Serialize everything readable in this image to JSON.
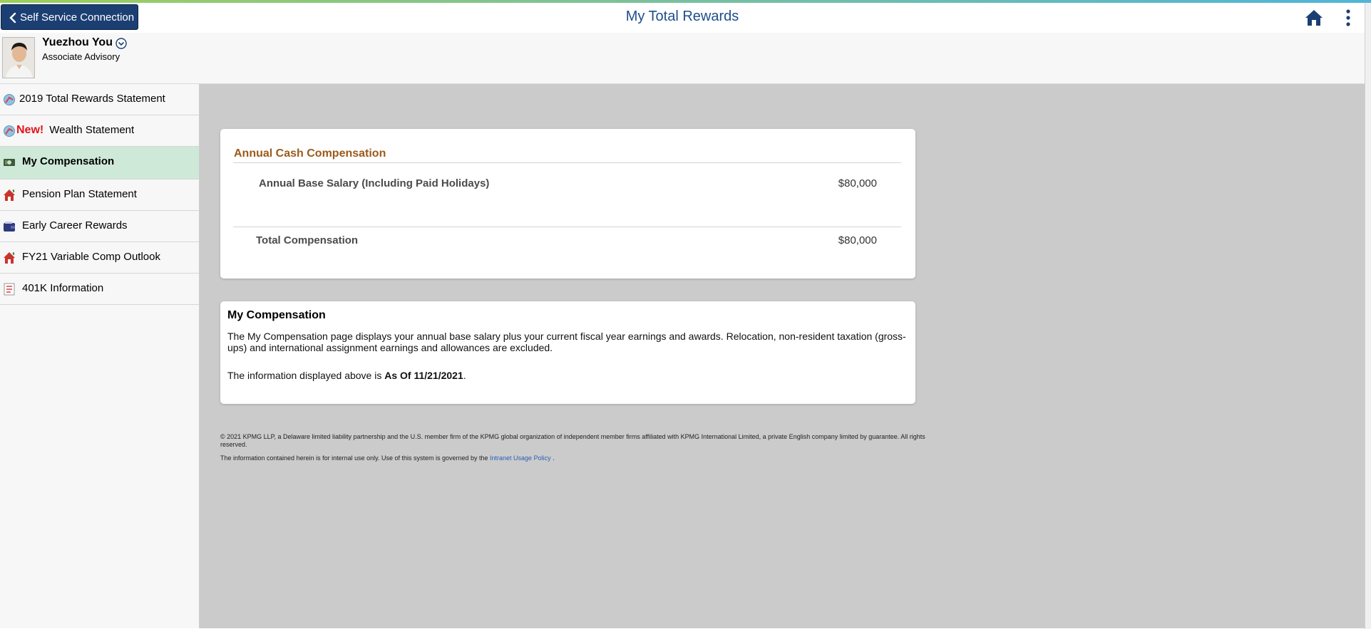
{
  "header": {
    "back_label": "Self Service Connection",
    "title": "My Total Rewards",
    "home_icon": "home-icon",
    "menu_icon": "more-vertical-icon",
    "title_color": "#1e4e8c",
    "back_color": "#1c3f73"
  },
  "user": {
    "name": "Yuezhou You",
    "role": "Associate Advisory"
  },
  "sidebar": {
    "items": [
      {
        "label": "2019 Total Rewards Statement",
        "icon": "statement-globe-icon"
      },
      {
        "badge": "New!",
        "label": "Wealth Statement",
        "icon": "statement-globe-icon"
      },
      {
        "label": "My Compensation",
        "icon": "money-icon",
        "active": true
      },
      {
        "label": "Pension Plan Statement",
        "icon": "house-icon"
      },
      {
        "label": "Early Career Rewards",
        "icon": "wallet-icon"
      },
      {
        "label": "FY21 Variable Comp Outlook",
        "icon": "house-icon"
      },
      {
        "label": "401K Information",
        "icon": "document-icon"
      }
    ],
    "active_color": "#cfe9d9"
  },
  "cash_card": {
    "title": "Annual Cash Compensation",
    "base_label": "Annual Base Salary (Including Paid Holidays)",
    "base_value": "$80,000",
    "total_label": "Total Compensation",
    "total_value": "$80,000",
    "title_color": "#9b5a1a"
  },
  "info_card": {
    "title": "My Compensation",
    "description": "The My Compensation page displays your annual base salary plus your current fiscal year earnings and awards. Relocation, non-resident taxation (gross-ups) and international assignment earnings and allowances are excluded.",
    "asof_prefix": "The information displayed above is ",
    "asof_bold": "As Of 11/21/2021",
    "asof_suffix": "."
  },
  "footer": {
    "copyright": "© 2021 KPMG LLP, a Delaware limited liability partnership and the U.S. member firm of the KPMG global organization of independent member firms affiliated with KPMG International Limited, a private English company limited by guarantee. All rights reserved.",
    "usage_prefix": "The information contained herein is for internal use only. Use of this system is governed by the ",
    "usage_link": "Intranet Usage Policy",
    "usage_suffix": " ."
  }
}
